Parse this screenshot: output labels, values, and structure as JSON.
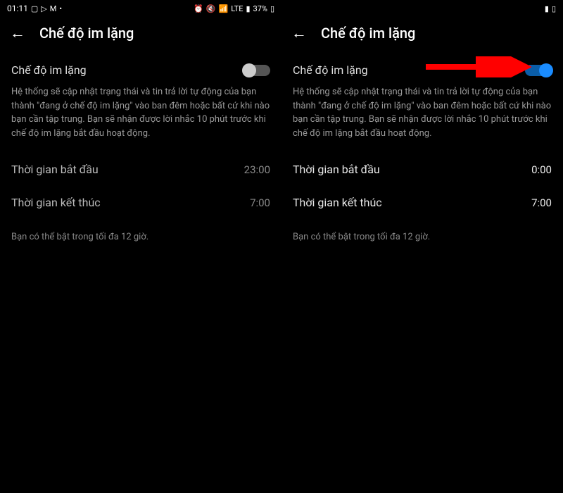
{
  "left": {
    "statusTime": "01:11",
    "batteryPercent": "37%",
    "headerTitle": "Chế độ im lặng",
    "toggleLabel": "Chế độ im lặng",
    "description": "Hệ thống sẽ cập nhật trạng thái và tin trả lời tự động của bạn thành \"đang ở chế độ im lặng\" vào ban đêm hoặc bất cứ khi nào bạn cần tập trung. Bạn sẽ nhận được lời nhắc 10 phút trước khi chế độ im lặng bắt đầu hoạt động.",
    "startLabel": "Thời gian bắt đầu",
    "startTime": "23:00",
    "endLabel": "Thời gian kết thúc",
    "endTime": "7:00",
    "footerNote": "Bạn có thể bật trong tối đa 12 giờ."
  },
  "right": {
    "headerTitle": "Chế độ im lặng",
    "toggleLabel": "Chế độ im lặng",
    "description": "Hệ thống sẽ cập nhật trạng thái và tin trả lời tự động của bạn thành \"đang ở chế độ im lặng\" vào ban đêm hoặc bất cứ khi nào bạn cần tập trung. Bạn sẽ nhận được lời nhắc 10 phút trước khi chế độ im lặng bắt đầu hoạt động.",
    "startLabel": "Thời gian bắt đầu",
    "startTime": "0:00",
    "endLabel": "Thời gian kết thúc",
    "endTime": "7:00",
    "footerNote": "Bạn có thể bật trong tối đa 12 giờ."
  }
}
